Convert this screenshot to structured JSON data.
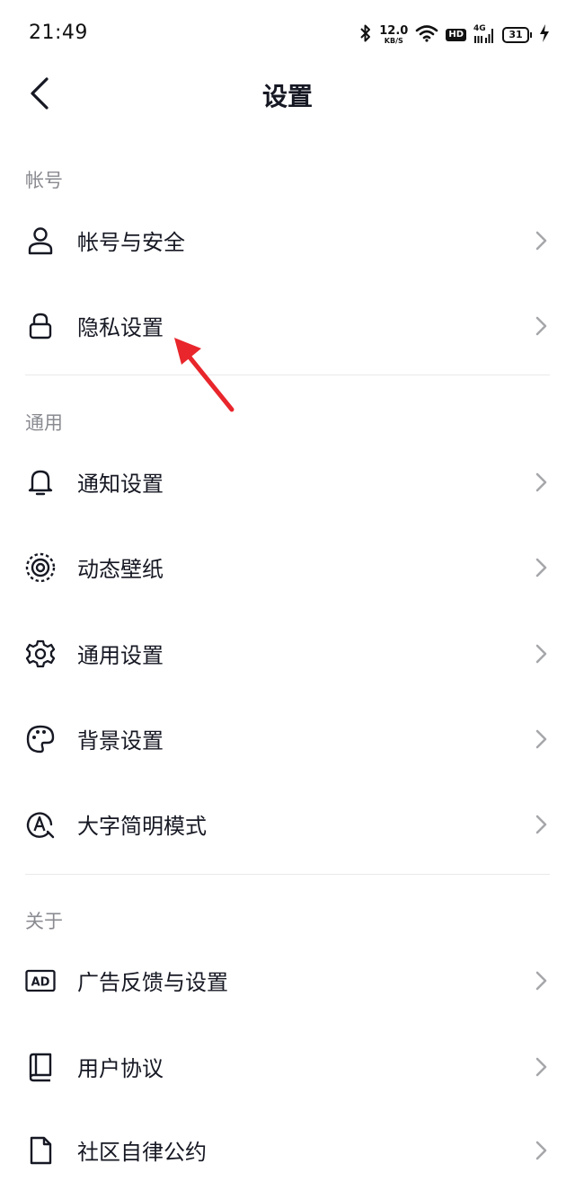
{
  "status_bar": {
    "time": "21:49",
    "net_speed_value": "12.0",
    "net_speed_unit": "KB/S",
    "hd_label": "HD",
    "network_type": "4G",
    "battery_level": "31",
    "icons": [
      "bluetooth-icon",
      "wifi-icon",
      "hd-icon",
      "signal-icon",
      "battery-icon",
      "charging-icon"
    ]
  },
  "header": {
    "title": "设置"
  },
  "sections": {
    "account": {
      "title": "帐号",
      "items": [
        {
          "label": "帐号与安全",
          "icon": "user-icon"
        },
        {
          "label": "隐私设置",
          "icon": "lock-icon"
        }
      ]
    },
    "general": {
      "title": "通用",
      "items": [
        {
          "label": "通知设置",
          "icon": "bell-icon"
        },
        {
          "label": "动态壁纸",
          "icon": "live-wallpaper-icon"
        },
        {
          "label": "通用设置",
          "icon": "gear-icon"
        },
        {
          "label": "背景设置",
          "icon": "palette-icon"
        },
        {
          "label": "大字简明模式",
          "icon": "large-font-icon"
        }
      ]
    },
    "about": {
      "title": "关于",
      "items": [
        {
          "label": "广告反馈与设置",
          "icon": "ad-icon"
        },
        {
          "label": "用户协议",
          "icon": "book-icon"
        },
        {
          "label": "社区自律公约",
          "icon": "document-icon"
        }
      ]
    }
  },
  "colors": {
    "text_primary": "#161823",
    "text_secondary": "#8a8b91",
    "divider": "#e9e9ec",
    "chevron": "#a6a7ab",
    "annotation_arrow": "#e8262b"
  }
}
